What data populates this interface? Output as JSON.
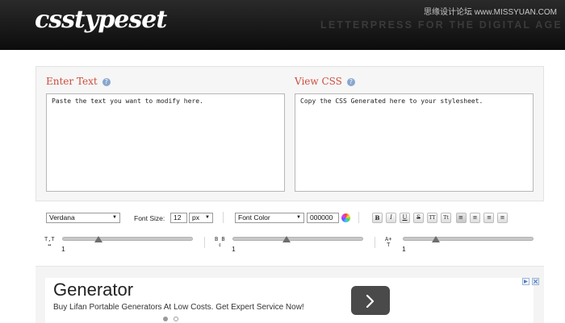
{
  "header": {
    "logo": "csstypeset",
    "tagline": "LETTERPRESS FOR THE DIGITAL AGE",
    "watermark": "思缘设计论坛 www.MISSYUAN.COM"
  },
  "editor": {
    "input": {
      "title": "Enter Text",
      "help": "?",
      "value": "Paste the text you want to modify here."
    },
    "output": {
      "title": "View CSS",
      "help": "?",
      "value": "Copy the CSS Generated here to your stylesheet."
    }
  },
  "controls": {
    "font_family": "Verdana",
    "font_size_label": "Font Size:",
    "font_size_value": "12",
    "font_size_unit": "px",
    "font_color_label": "Font Color",
    "font_color_value": "000000",
    "format_buttons": [
      "B",
      "I",
      "U",
      "S",
      "TT",
      "Tt",
      "≡",
      "≡",
      "≡",
      "≡"
    ],
    "sliders": [
      {
        "icon_top": "T,T",
        "icon_bottom": "↔",
        "value": "1",
        "level": 0.28
      },
      {
        "icon_top": "B B",
        "icon_bottom": "⇕",
        "value": "1",
        "level": 0.44
      },
      {
        "icon_top": "A+",
        "icon_bottom": "T",
        "value": "1",
        "level": 0.26
      }
    ]
  },
  "ad": {
    "title": "Generator",
    "description": "Buy Lifan Portable Generators At Low Costs. Get Expert Service Now!",
    "button_icon": "chevron-right-icon"
  },
  "colors": {
    "accent": "#cc4d3e",
    "header_bg": "#111111",
    "help_icon": "#8aa6cf"
  }
}
